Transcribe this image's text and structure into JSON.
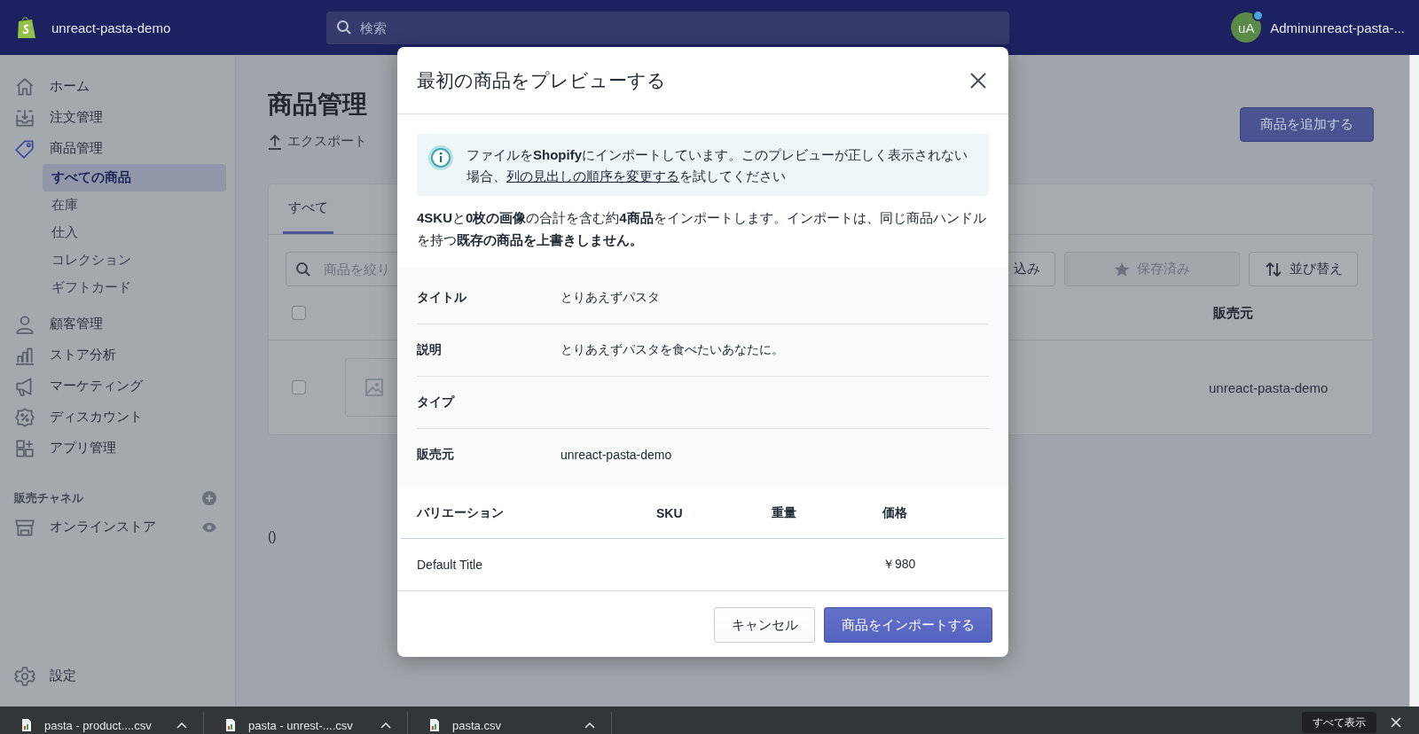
{
  "top_bar": {
    "store_name": "unreact-pasta-demo",
    "search": {
      "placeholder": "検索"
    },
    "account": {
      "initials": "uA",
      "name": "Adminunreact-pasta-..."
    }
  },
  "sidebar": {
    "items": [
      {
        "label": "ホーム",
        "selected": false
      },
      {
        "label": "注文管理",
        "selected": false
      },
      {
        "label": "商品管理",
        "selected": true,
        "children": [
          {
            "label": "すべての商品",
            "selected": true
          },
          {
            "label": "在庫",
            "selected": false
          },
          {
            "label": "仕入",
            "selected": false
          },
          {
            "label": "コレクション",
            "selected": false
          },
          {
            "label": "ギフトカード",
            "selected": false
          }
        ]
      },
      {
        "label": "顧客管理",
        "selected": false
      },
      {
        "label": "ストア分析",
        "selected": false
      },
      {
        "label": "マーケティング",
        "selected": false
      },
      {
        "label": "ディスカウント",
        "selected": false
      },
      {
        "label": "アプリ管理",
        "selected": false
      }
    ],
    "sales_channels": {
      "heading": "販売チャネル",
      "items": [
        {
          "label": "オンラインストア"
        }
      ]
    },
    "settings": {
      "label": "設定"
    }
  },
  "page": {
    "title": "商品管理",
    "export_label": "エクスポート",
    "add_button": "商品を追加する",
    "tabs": [
      {
        "label": "すべて",
        "selected": true
      }
    ],
    "search": {
      "placeholder": "商品を絞り"
    },
    "filter_button": "込み",
    "saved_button": {
      "label": "保存済み",
      "disabled": true
    },
    "sort_button": "並び替え",
    "table": {
      "header_checked": false,
      "vendor_column": "販売元",
      "rows": [
        {
          "checked": false,
          "vendor": "unreact-pasta-demo"
        }
      ]
    },
    "footer_note": "()"
  },
  "modal": {
    "title": "最初の商品をプレビューする",
    "banner": {
      "text_before": "ファイルを**Shopify**にインポートしています。このプレビューが正しく表示されない場合、",
      "link": "列の見出しの順序を変更する",
      "text_after": "を試してください"
    },
    "summary": "**4SKU**と**0枚の画像**の合計を含む約**4商品**をインポートします。インポートは、同じ商品ハンドルを持つ**既存の商品を上書きしません。**",
    "details": [
      {
        "label": "タイトル",
        "value": "とりあえずパスタ"
      },
      {
        "label": "説明",
        "value": "とりあえずパスタを食べたいあなたに。"
      },
      {
        "label": "タイプ"
      },
      {
        "label": "販売元",
        "value": "unreact-pasta-demo"
      }
    ],
    "variants": {
      "columns": [
        "バリエーション",
        "SKU",
        "重量",
        "価格"
      ],
      "rows": [
        {
          "variant": "Default Title",
          "price": "￥980"
        }
      ]
    },
    "buttons": [
      {
        "label": "キャンセル",
        "kind": "secondary"
      },
      {
        "label": "商品をインポートする",
        "kind": "primary"
      }
    ]
  },
  "downloads": {
    "items": [
      {
        "name": "pasta - product....csv"
      },
      {
        "name": "pasta - unrest-....csv"
      },
      {
        "name": "pasta.csv"
      }
    ],
    "show_all": "すべて表示"
  }
}
